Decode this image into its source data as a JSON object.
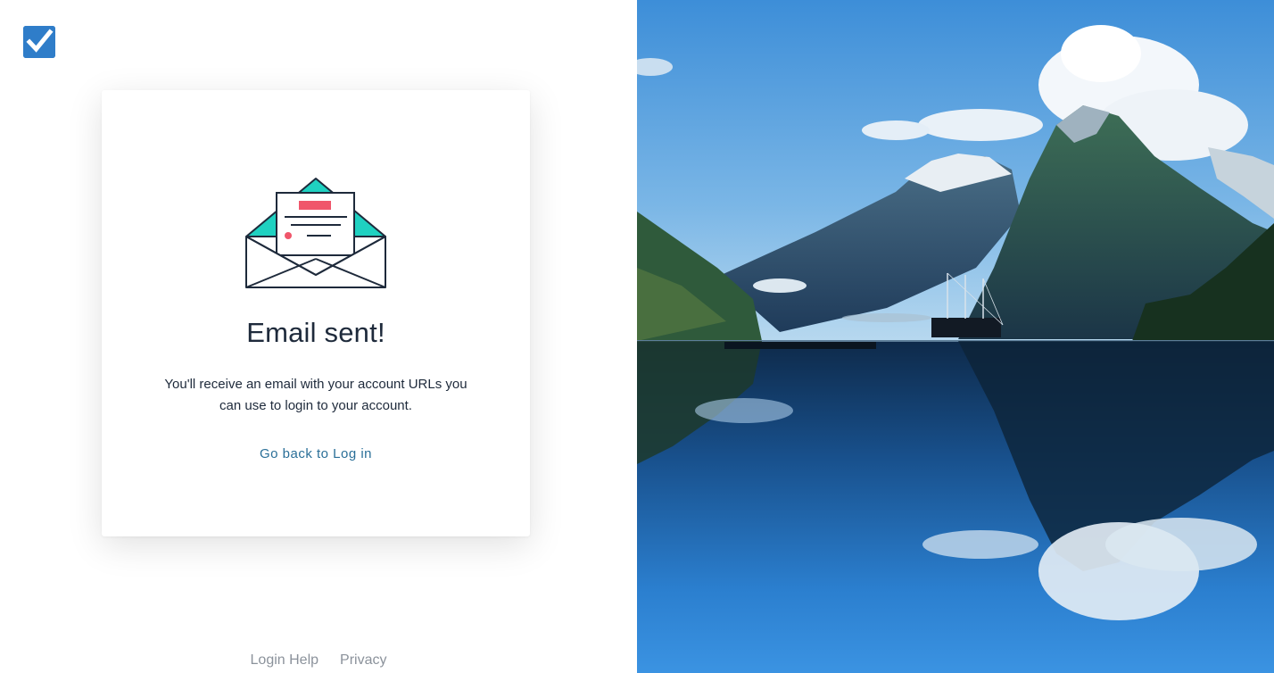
{
  "card": {
    "title": "Email sent!",
    "message": "You'll receive an email with your account URLs you can use to login to your account.",
    "back_link": "Go back to Log in"
  },
  "footer": {
    "login_help": "Login Help",
    "privacy": "Privacy"
  },
  "icons": {
    "logo": "checkbox-logo-icon",
    "envelope": "open-envelope-icon"
  },
  "colors": {
    "brand_blue": "#2f7dc9",
    "link": "#2a6f98",
    "heading": "#1e2a3b",
    "envelope_teal": "#1fd1c1",
    "envelope_red": "#f0566b",
    "footer_text": "#8b929b"
  }
}
